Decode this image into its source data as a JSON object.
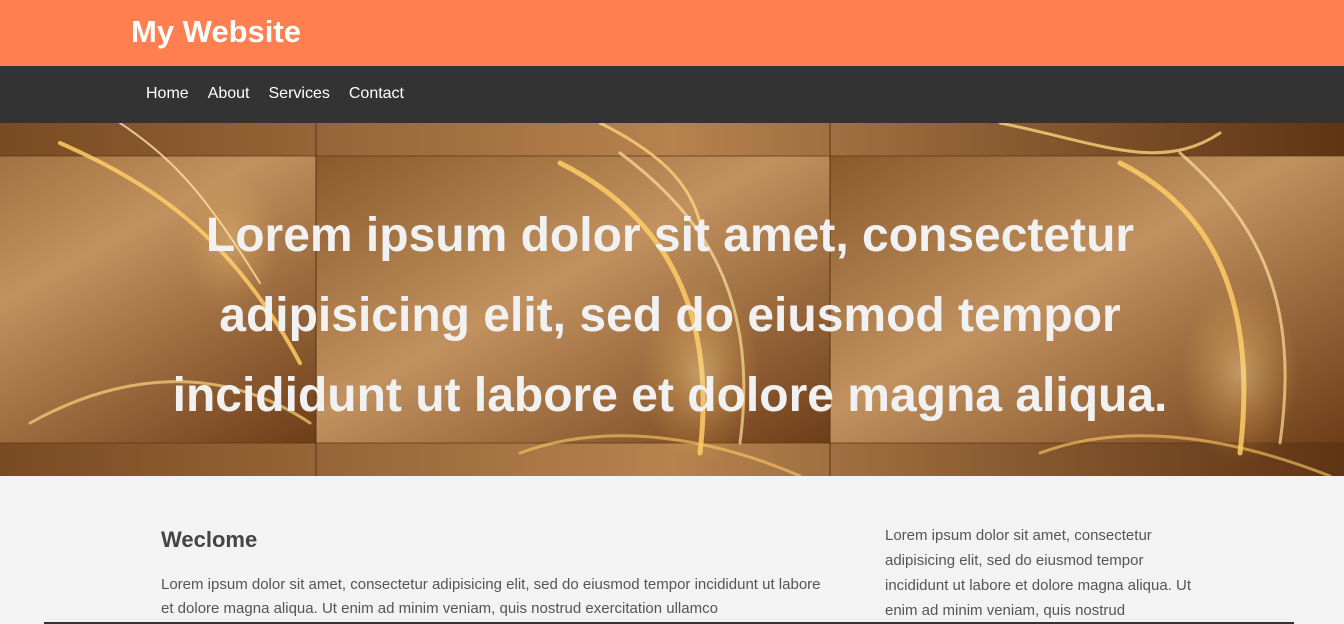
{
  "header": {
    "title": "My Website"
  },
  "nav": {
    "items": [
      "Home",
      "About",
      "Services",
      "Contact"
    ]
  },
  "hero": {
    "heading": "Lorem ipsum dolor sit amet, consectetur adipisicing elit, sed do eiusmod tempor incididunt ut labore et dolore magna aliqua."
  },
  "main": {
    "heading": "Weclome",
    "body": "Lorem ipsum dolor sit amet, consectetur adipisicing elit, sed do eiusmod tempor incididunt ut labore et dolore magna aliqua. Ut enim ad minim veniam, quis nostrud exercitation ullamco",
    "sidebar_text": "Lorem ipsum dolor sit amet, consectetur adipisicing elit, sed do eiusmod tempor incididunt ut labore et dolore magna aliqua. Ut enim ad minim veniam, quis nostrud"
  },
  "colors": {
    "header_bg": "#ff7f50",
    "nav_bg": "#333333",
    "page_bg": "#f3f3f3"
  }
}
